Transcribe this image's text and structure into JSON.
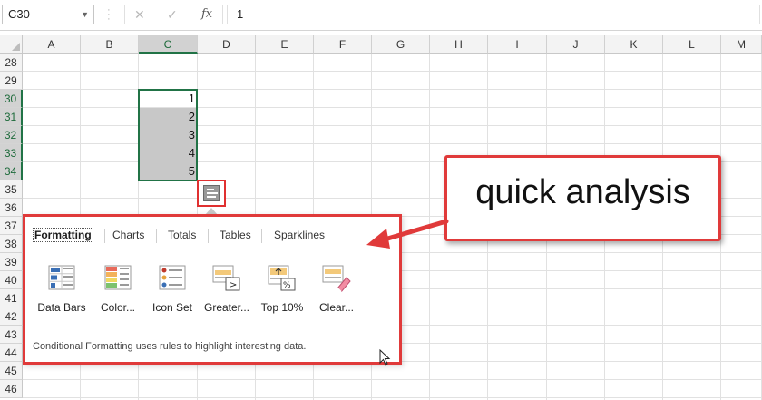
{
  "formula_bar": {
    "name_box": "C30",
    "cancel_icon": "✕",
    "enter_icon": "✓",
    "function_icon": "fx",
    "formula_value": "1"
  },
  "columns": [
    "A",
    "B",
    "C",
    "D",
    "E",
    "F",
    "G",
    "H",
    "I",
    "J",
    "K",
    "L",
    "M"
  ],
  "rows": [
    "28",
    "29",
    "30",
    "31",
    "32",
    "33",
    "34",
    "35",
    "36",
    "37",
    "38",
    "39",
    "40",
    "41",
    "42",
    "43",
    "44",
    "45",
    "46"
  ],
  "selection": {
    "column": "C",
    "rows": [
      "30",
      "31",
      "32",
      "33",
      "34"
    ]
  },
  "cells": [
    {
      "ref": "C30",
      "value": "1"
    },
    {
      "ref": "C31",
      "value": "2"
    },
    {
      "ref": "C32",
      "value": "3"
    },
    {
      "ref": "C33",
      "value": "4"
    },
    {
      "ref": "C34",
      "value": "5"
    }
  ],
  "quick_analysis": {
    "button_icon": "quick-analysis-icon",
    "tabs": [
      {
        "label": "Formatting",
        "active": true
      },
      {
        "label": "Charts",
        "active": false
      },
      {
        "label": "Totals",
        "active": false
      },
      {
        "label": "Tables",
        "active": false
      },
      {
        "label": "Sparklines",
        "active": false
      }
    ],
    "tools": [
      {
        "label": "Data Bars",
        "icon": "data-bars-icon"
      },
      {
        "label": "Color...",
        "icon": "color-scale-icon"
      },
      {
        "label": "Icon Set",
        "icon": "icon-set-icon"
      },
      {
        "label": "Greater...",
        "icon": "greater-than-icon"
      },
      {
        "label": "Top 10%",
        "icon": "top-10-percent-icon"
      },
      {
        "label": "Clear...",
        "icon": "clear-format-icon"
      }
    ],
    "description": "Conditional Formatting uses rules to highlight interesting data."
  },
  "annotation": {
    "callout_text": "quick analysis",
    "accent_color": "#e03a3a"
  }
}
